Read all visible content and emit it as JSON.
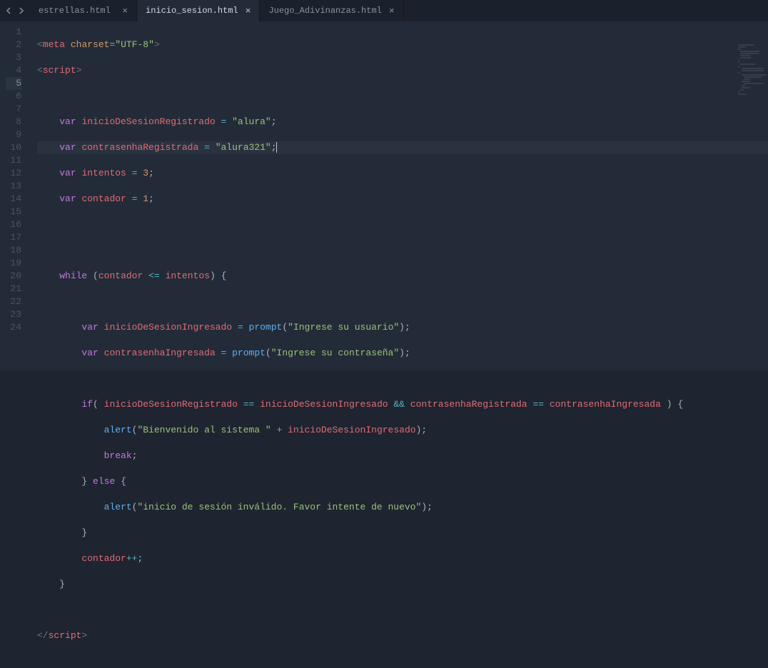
{
  "tabs": [
    {
      "label": "estrellas.html",
      "active": false
    },
    {
      "label": "inicio_sesion.html",
      "active": true
    },
    {
      "label": "Juego_Adivinanzas.html",
      "active": false
    }
  ],
  "current_line": 5,
  "code": {
    "l1": {
      "open": "<",
      "tag": "meta",
      "sp": " ",
      "attr": "charset",
      "eq": "=",
      "val": "\"UTF-8\"",
      "close": ">"
    },
    "l2": {
      "open": "<",
      "tag": "script",
      "close": ">"
    },
    "l4": {
      "indent": "    ",
      "kw": "var",
      "sp": " ",
      "id": "inicioDeSesionRegistrado",
      "sp2": " ",
      "op": "=",
      "sp3": " ",
      "str": "\"alura\"",
      "semi": ";"
    },
    "l5": {
      "indent": "    ",
      "kw": "var",
      "sp": " ",
      "id": "contrasenhaRegistrada",
      "sp2": " ",
      "op": "=",
      "sp3": " ",
      "str": "\"alura321\"",
      "semi": ";"
    },
    "l6": {
      "indent": "    ",
      "kw": "var",
      "sp": " ",
      "id": "intentos",
      "sp2": " ",
      "op": "=",
      "sp3": " ",
      "num": "3",
      "semi": ";"
    },
    "l7": {
      "indent": "    ",
      "kw": "var",
      "sp": " ",
      "id": "contador",
      "sp2": " ",
      "op": "=",
      "sp3": " ",
      "num": "1",
      "semi": ";"
    },
    "l10": {
      "indent": "    ",
      "kw": "while",
      "sp": " ",
      "paren": "(",
      "id": "contador",
      "sp2": " ",
      "op": "<=",
      "sp3": " ",
      "id2": "intentos",
      "paren2": ")",
      "sp4": " ",
      "brace": "{"
    },
    "l12": {
      "indent": "        ",
      "kw": "var",
      "sp": " ",
      "id": "inicioDeSesionIngresado",
      "sp2": " ",
      "op": "=",
      "sp3": " ",
      "fn": "prompt",
      "paren": "(",
      "str": "\"Ingrese su usuario\"",
      "paren2": ")",
      "semi": ";"
    },
    "l13": {
      "indent": "        ",
      "kw": "var",
      "sp": " ",
      "id": "contrasenhaIngresada",
      "sp2": " ",
      "op": "=",
      "sp3": " ",
      "fn": "prompt",
      "paren": "(",
      "str": "\"Ingrese su contraseña\"",
      "paren2": ")",
      "semi": ";"
    },
    "l15": {
      "indent": "        ",
      "kw": "if",
      "paren": "(",
      "sp": " ",
      "id": "inicioDeSesionRegistrado",
      "sp2": " ",
      "op": "==",
      "sp3": " ",
      "id2": "inicioDeSesionIngresado",
      "sp4": " ",
      "op2": "&&",
      "sp5": " ",
      "id3": "contrasenhaRegistrada",
      "sp6": " ",
      "op3": "==",
      "sp7": " ",
      "id4": "contrasenhaIngresada",
      "sp8": " ",
      "paren2": ")",
      "sp9": " ",
      "brace": "{"
    },
    "l16": {
      "indent": "            ",
      "fn": "alert",
      "paren": "(",
      "str": "\"Bienvenido al sistema \"",
      "sp": " ",
      "op": "+",
      "sp2": " ",
      "id": "inicioDeSesionIngresado",
      "paren2": ")",
      "semi": ";"
    },
    "l17": {
      "indent": "            ",
      "kw": "break",
      "semi": ";"
    },
    "l18": {
      "indent": "        ",
      "brace": "}",
      "sp": " ",
      "kw": "else",
      "sp2": " ",
      "brace2": "{"
    },
    "l19": {
      "indent": "            ",
      "fn": "alert",
      "paren": "(",
      "str": "\"inicio de sesión inválido. Favor intente de nuevo\"",
      "paren2": ")",
      "semi": ";"
    },
    "l20": {
      "indent": "        ",
      "brace": "}"
    },
    "l21": {
      "indent": "        ",
      "id": "contador",
      "op": "++",
      "semi": ";"
    },
    "l22": {
      "indent": "    ",
      "brace": "}"
    },
    "l24": {
      "open": "</",
      "tag": "script",
      "close": ">"
    }
  },
  "line_numbers": [
    "1",
    "2",
    "3",
    "4",
    "5",
    "6",
    "7",
    "8",
    "9",
    "10",
    "11",
    "12",
    "13",
    "14",
    "15",
    "16",
    "17",
    "18",
    "19",
    "20",
    "21",
    "22",
    "23",
    "24"
  ]
}
